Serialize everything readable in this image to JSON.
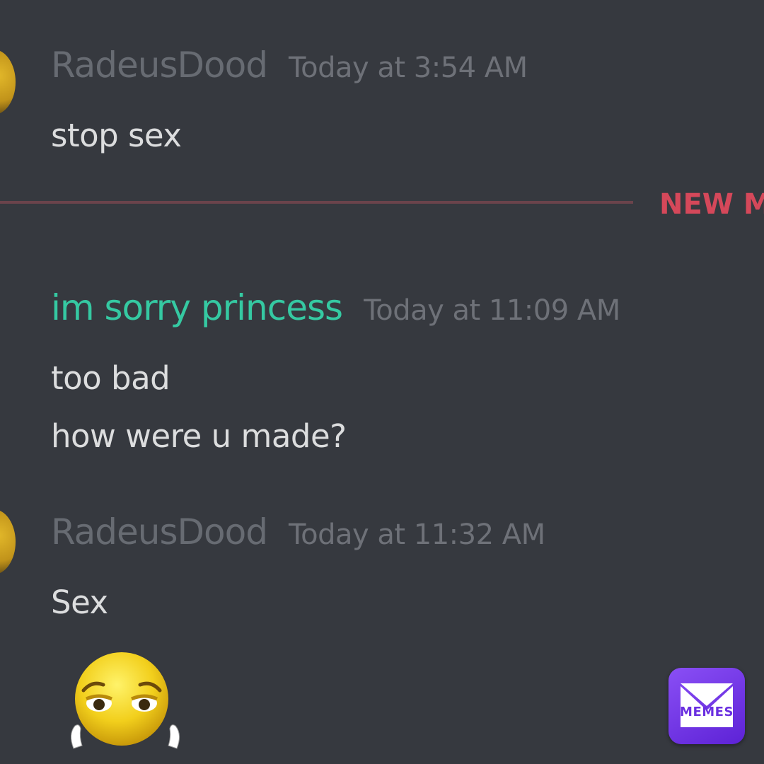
{
  "messages": [
    {
      "username": "RadeusDood",
      "timestamp": "Today at 3:54 AM",
      "lines": [
        "stop sex"
      ]
    },
    {
      "username": "im sorry princess",
      "timestamp": "Today at 11:09 AM",
      "lines": [
        "too bad",
        "how were u made?"
      ]
    },
    {
      "username": "RadeusDood",
      "timestamp": "Today at 11:32 AM",
      "lines": [
        "Sex"
      ],
      "emoji": "pleading-grabby-hands-emoji"
    }
  ],
  "divider": {
    "label": "NEW M",
    "color": "#d5485a"
  },
  "watermark": {
    "label": "MEMES",
    "icon": "envelope-icon"
  },
  "colors": {
    "background": "#36393f",
    "username_default": "#676b72",
    "username_role": "#35c9a2",
    "message_text": "#dcddde",
    "timestamp": "#6e7178"
  }
}
